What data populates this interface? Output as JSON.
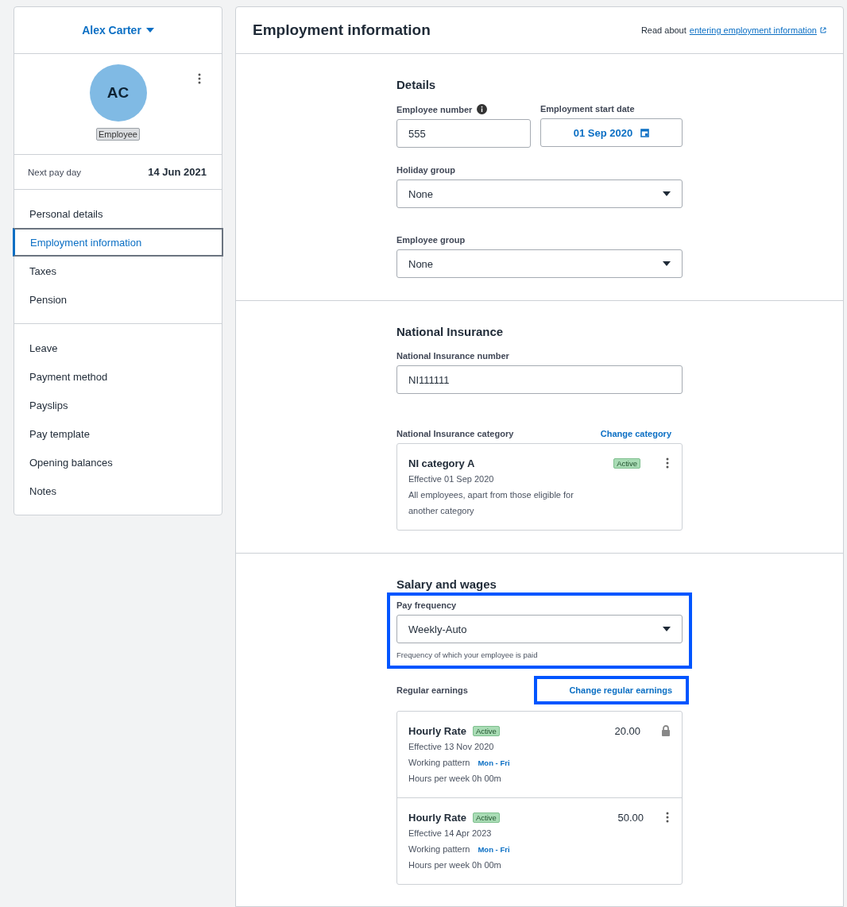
{
  "sidebar": {
    "employee_name": "Alex Carter",
    "initials": "AC",
    "role_badge": "Employee",
    "next_pay_day": {
      "label": "Next pay day",
      "value": "14 Jun 2021"
    },
    "nav_groups": [
      [
        {
          "label": "Personal details",
          "selected": false
        },
        {
          "label": "Employment information",
          "selected": true
        },
        {
          "label": "Taxes",
          "selected": false
        },
        {
          "label": "Pension",
          "selected": false
        }
      ],
      [
        {
          "label": "Leave",
          "selected": false
        },
        {
          "label": "Payment method",
          "selected": false
        },
        {
          "label": "Payslips",
          "selected": false
        },
        {
          "label": "Pay template",
          "selected": false
        },
        {
          "label": "Opening balances",
          "selected": false
        },
        {
          "label": "Notes",
          "selected": false
        }
      ]
    ]
  },
  "main": {
    "title": "Employment information",
    "help": {
      "prefix": "Read about",
      "link": "entering employment information"
    },
    "details": {
      "heading": "Details",
      "employee_number": {
        "label": "Employee number",
        "value": "555"
      },
      "start_date": {
        "label": "Employment start date",
        "value": "01 Sep 2020"
      },
      "holiday_group": {
        "label": "Holiday group",
        "value": "None"
      },
      "employee_group": {
        "label": "Employee group",
        "value": "None"
      }
    },
    "national_insurance": {
      "heading": "National Insurance",
      "number": {
        "label": "National Insurance number",
        "value": "NI111111"
      },
      "category": {
        "label": "National Insurance category",
        "action": "Change category",
        "card": {
          "title": "NI category A",
          "badge": "Active",
          "effective": "Effective 01 Sep 2020",
          "description": "All employees, apart from those eligible for another category"
        }
      }
    },
    "salary": {
      "heading": "Salary and wages",
      "pay_frequency": {
        "label": "Pay frequency",
        "value": "Weekly-Auto",
        "hint": "Frequency of which your employee is paid",
        "highlighted": true
      },
      "regular_earnings": {
        "label": "Regular earnings",
        "action": "Change regular earnings",
        "action_highlighted": true,
        "items": [
          {
            "title": "Hourly Rate",
            "badge": "Active",
            "effective": "Effective 13 Nov 2020",
            "pattern_label": "Working pattern",
            "pattern": "Mon - Fri",
            "hours": "Hours per week 0h 00m",
            "amount": "20.00",
            "locked": true
          },
          {
            "title": "Hourly Rate",
            "badge": "Active",
            "effective": "Effective 14 Apr 2023",
            "pattern_label": "Working pattern",
            "pattern": "Mon - Fri",
            "hours": "Hours per week 0h 00m",
            "amount": "50.00",
            "locked": false
          }
        ]
      }
    }
  }
}
